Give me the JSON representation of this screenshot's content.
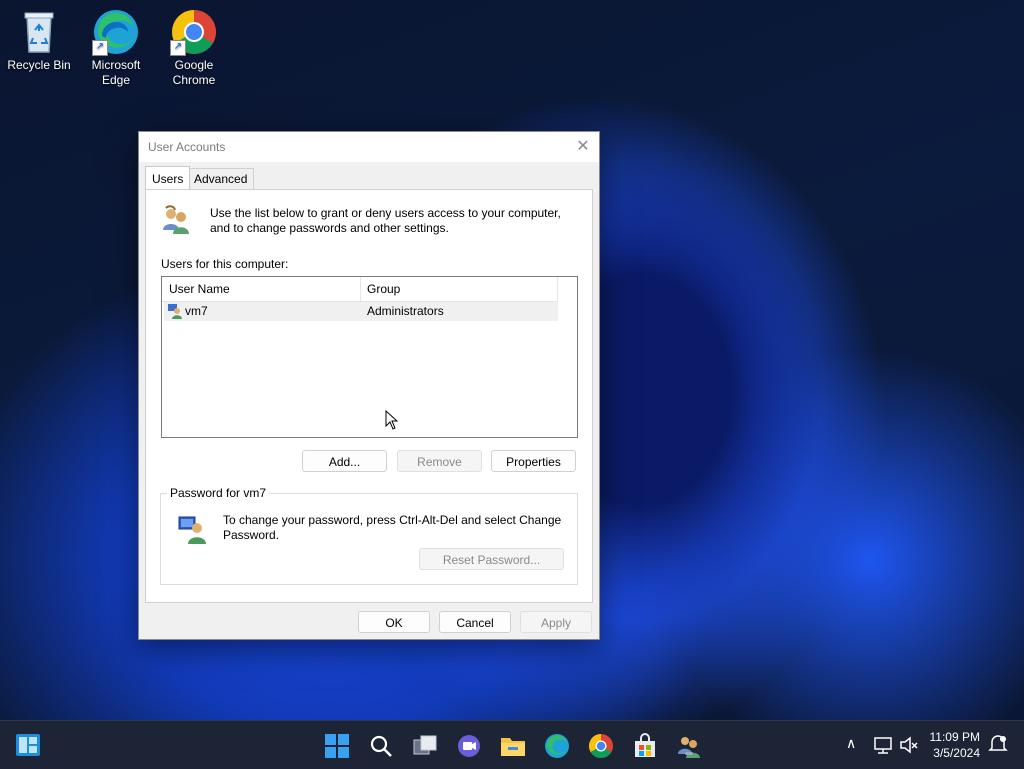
{
  "desktop": {
    "icons": [
      {
        "label": "Recycle Bin"
      },
      {
        "label": "Microsoft Edge"
      },
      {
        "label": "Google Chrome"
      }
    ]
  },
  "dialog": {
    "title": "User Accounts",
    "tabs": [
      {
        "label": "Users"
      },
      {
        "label": "Advanced"
      }
    ],
    "description": "Use the list below to grant or deny users access to your computer, and to change passwords and other settings.",
    "users_label": "Users for this computer:",
    "columns": [
      "User Name",
      "Group"
    ],
    "rows": [
      {
        "name": "vm7",
        "group": "Administrators"
      }
    ],
    "buttons": {
      "add": "Add...",
      "remove": "Remove",
      "properties": "Properties"
    },
    "password_group": {
      "label": "Password for vm7",
      "text": "To change your password, press Ctrl-Alt-Del and select Change Password.",
      "reset": "Reset Password..."
    },
    "footer": {
      "ok": "OK",
      "cancel": "Cancel",
      "apply": "Apply"
    }
  },
  "taskbar": {
    "time": "11:09 PM",
    "date": "3/5/2024"
  },
  "colors": {
    "accent": "#0078d4",
    "taskbar": "#1c2436"
  }
}
